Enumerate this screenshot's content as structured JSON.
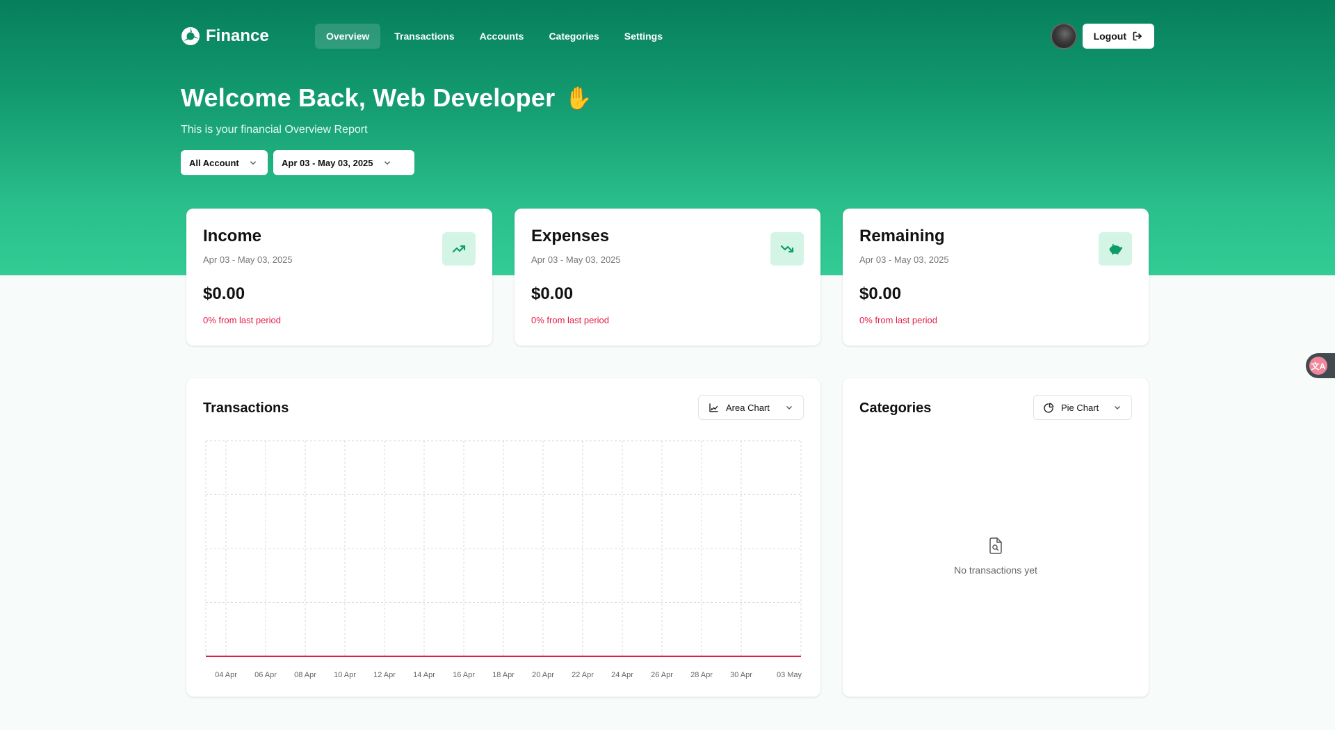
{
  "brand": {
    "name": "Finance"
  },
  "nav": {
    "links": [
      "Overview",
      "Transactions",
      "Accounts",
      "Categories",
      "Settings"
    ],
    "active": "Overview",
    "logout_label": "Logout"
  },
  "hero": {
    "welcome": "Welcome Back, Web Developer",
    "wave_emoji": "✋",
    "subtitle": "This is your financial Overview Report"
  },
  "filters": {
    "account": "All Account",
    "date_range": "Apr 03 - May 03, 2025"
  },
  "stats": [
    {
      "title": "Income",
      "range": "Apr 03 - May 03, 2025",
      "amount": "$0.00",
      "change": "0% from last period",
      "icon": "trending-up-icon"
    },
    {
      "title": "Expenses",
      "range": "Apr 03 - May 03, 2025",
      "amount": "$0.00",
      "change": "0% from last period",
      "icon": "trending-down-icon"
    },
    {
      "title": "Remaining",
      "range": "Apr 03 - May 03, 2025",
      "amount": "$0.00",
      "change": "0% from last period",
      "icon": "piggy-bank-icon"
    }
  ],
  "transactions_panel": {
    "title": "Transactions",
    "chart_type_label": "Area Chart"
  },
  "categories_panel": {
    "title": "Categories",
    "chart_type_label": "Pie Chart",
    "empty_text": "No transactions yet"
  },
  "chart_data": {
    "type": "area",
    "categories": [
      "04 Apr",
      "06 Apr",
      "08 Apr",
      "10 Apr",
      "12 Apr",
      "14 Apr",
      "16 Apr",
      "18 Apr",
      "20 Apr",
      "22 Apr",
      "24 Apr",
      "26 Apr",
      "28 Apr",
      "30 Apr",
      "03 May"
    ],
    "series": [
      {
        "values": [
          0,
          0,
          0,
          0,
          0,
          0,
          0,
          0,
          0,
          0,
          0,
          0,
          0,
          0,
          0
        ],
        "color": "#e11d48"
      }
    ],
    "grid": true,
    "xlabel": "",
    "ylabel": ""
  },
  "colors": {
    "brand_green": "#0f8f66",
    "accent_green_light": "#d4f5e6",
    "negative": "#e11d48"
  }
}
